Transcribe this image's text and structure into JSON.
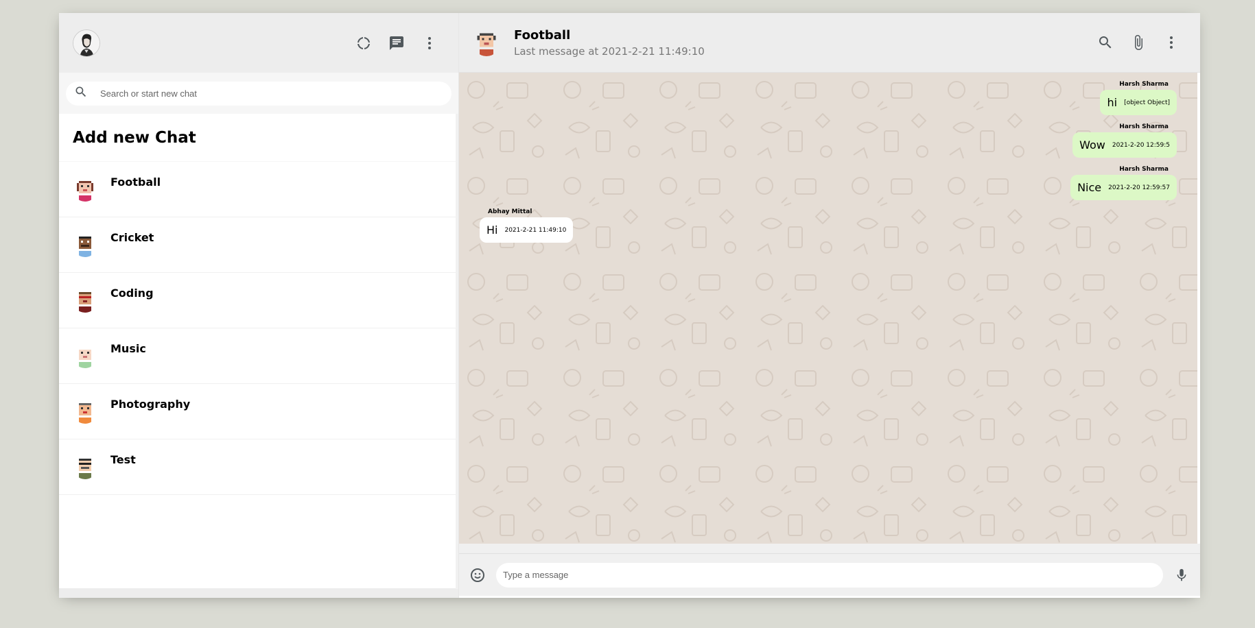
{
  "sidebar": {
    "search_placeholder": "Search or start new chat",
    "add_chat_label": "Add new Chat",
    "rooms": [
      {
        "name": "Football"
      },
      {
        "name": "Cricket"
      },
      {
        "name": "Coding"
      },
      {
        "name": "Music"
      },
      {
        "name": "Photography"
      },
      {
        "name": "Test"
      }
    ]
  },
  "chat": {
    "room_name": "Football",
    "last_seen": "Last message at 2021-2-21 11:49:10",
    "input_placeholder": "Type a message",
    "messages": [
      {
        "sender": "Harsh Sharma",
        "text": "hi",
        "time": "[object Object]",
        "side": "right"
      },
      {
        "sender": "Harsh Sharma",
        "text": "Wow",
        "time": "2021-2-20 12:59:5",
        "side": "right"
      },
      {
        "sender": "Harsh Sharma",
        "text": "Nice",
        "time": "2021-2-20 12:59:57",
        "side": "right"
      }
    ],
    "received": [
      {
        "sender": "Abhay Mittal",
        "text": "Hi",
        "time": "2021-2-21 11:49:10",
        "side": "left"
      }
    ]
  },
  "icons": {
    "status": "status-icon",
    "new_chat": "chat-icon",
    "menu": "more-vert-icon",
    "search": "search-icon",
    "attach": "attach-icon",
    "emoji": "emoji-icon",
    "mic": "mic-icon"
  },
  "colors": {
    "header_bg": "#ededed",
    "chat_bg": "#e5ddd5",
    "sent_bubble": "#dcf8c6",
    "received_bubble": "#ffffff"
  }
}
